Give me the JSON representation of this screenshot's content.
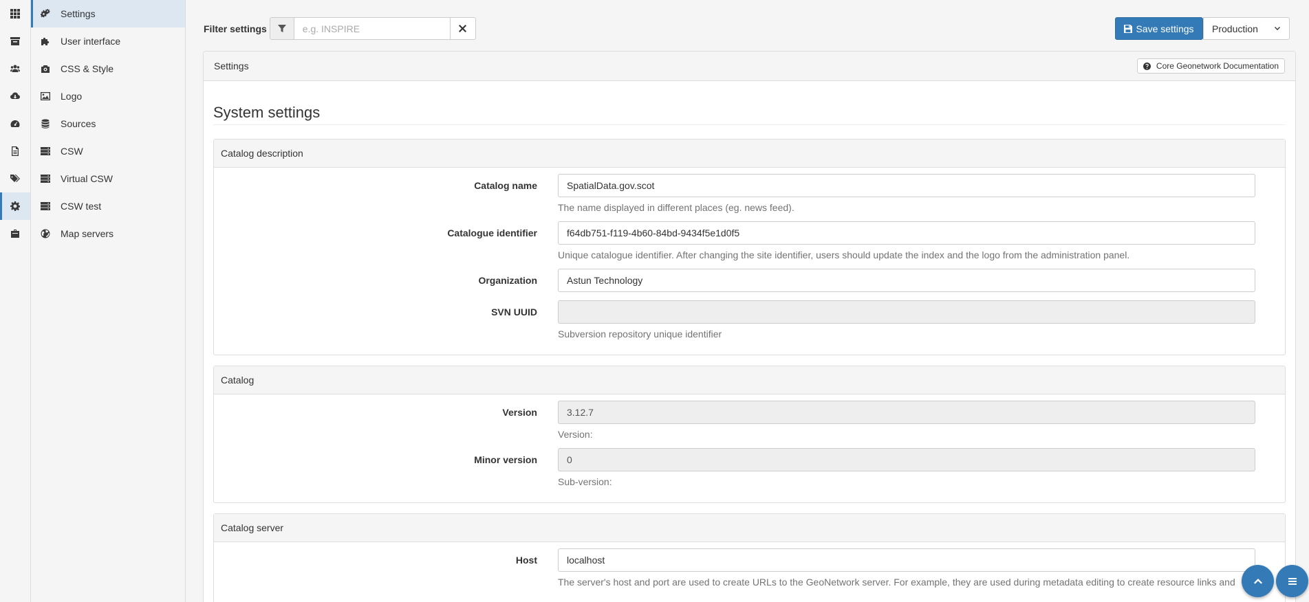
{
  "rail": {
    "icons": [
      "grid-icon",
      "inbox-icon",
      "users-icon",
      "cloud-download-icon",
      "dashboard-icon",
      "file-icon",
      "tags-icon",
      "cog-icon",
      "briefcase-icon"
    ],
    "active_index": 7
  },
  "submenu": {
    "items": [
      {
        "label": "Settings",
        "icon": "cogs-icon",
        "active": true
      },
      {
        "label": "User interface",
        "icon": "puzzle-icon"
      },
      {
        "label": "CSS & Style",
        "icon": "camera-icon"
      },
      {
        "label": "Logo",
        "icon": "image-icon"
      },
      {
        "label": "Sources",
        "icon": "database-icon"
      },
      {
        "label": "CSW",
        "icon": "server-icon"
      },
      {
        "label": "Virtual CSW",
        "icon": "server-icon"
      },
      {
        "label": "CSW test",
        "icon": "server-icon"
      },
      {
        "label": "Map servers",
        "icon": "globe-icon"
      }
    ]
  },
  "toolbar": {
    "filter_label": "Filter settings",
    "filter_placeholder": "e.g. INSPIRE",
    "filter_value": "",
    "save_label": "Save settings",
    "env_selected": "Production"
  },
  "panel": {
    "title": "Settings",
    "doc_button": "Core Geonetwork Documentation",
    "heading": "System settings"
  },
  "sections": {
    "catalog_description": {
      "title": "Catalog description",
      "catalog_name": {
        "label": "Catalog name",
        "value": "SpatialData.gov.scot",
        "help": "The name displayed in different places (eg. news feed)."
      },
      "catalogue_identifier": {
        "label": "Catalogue identifier",
        "value": "f64db751-f119-4b60-84bd-9434f5e1d0f5",
        "help": "Unique catalogue identifier. After changing the site identifier, users should update the index and the logo from the administration panel."
      },
      "organization": {
        "label": "Organization",
        "value": "Astun Technology"
      },
      "svn_uuid": {
        "label": "SVN UUID",
        "value": "",
        "help": "Subversion repository unique identifier"
      }
    },
    "catalog": {
      "title": "Catalog",
      "version": {
        "label": "Version",
        "value": "3.12.7",
        "help": "Version:"
      },
      "minor_version": {
        "label": "Minor version",
        "value": "0",
        "help": "Sub-version:"
      }
    },
    "catalog_server": {
      "title": "Catalog server",
      "host": {
        "label": "Host",
        "value": "localhost",
        "help": "The server's host and port are used to create URLs to the GeoNetwork server. For example, they are used during metadata editing to create resource links and"
      }
    }
  },
  "colors": {
    "accent": "#337ab7",
    "active_bg": "#dde7f2"
  }
}
